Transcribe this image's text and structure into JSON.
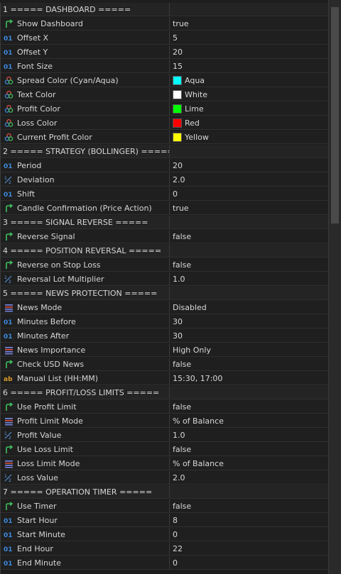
{
  "rows": [
    {
      "type": "group",
      "label": "1 ===== DASHBOARD ====="
    },
    {
      "type": "param",
      "icon": "bool",
      "label": "Show Dashboard",
      "value": "true"
    },
    {
      "type": "param",
      "icon": "int",
      "label": "Offset X",
      "value": "5"
    },
    {
      "type": "param",
      "icon": "int",
      "label": "Offset Y",
      "value": "20"
    },
    {
      "type": "param",
      "icon": "int",
      "label": "Font Size",
      "value": "15"
    },
    {
      "type": "param",
      "icon": "color",
      "label": "Spread Color (Cyan/Aqua)",
      "value": "Aqua",
      "swatch": "#00ffff"
    },
    {
      "type": "param",
      "icon": "color",
      "label": "Text Color",
      "value": "White",
      "swatch": "#ffffff"
    },
    {
      "type": "param",
      "icon": "color",
      "label": "Profit Color",
      "value": "Lime",
      "swatch": "#00ff00"
    },
    {
      "type": "param",
      "icon": "color",
      "label": "Loss Color",
      "value": "Red",
      "swatch": "#ff0000"
    },
    {
      "type": "param",
      "icon": "color",
      "label": "Current Profit Color",
      "value": "Yellow",
      "swatch": "#ffff00"
    },
    {
      "type": "group",
      "label": "2 ===== STRATEGY (BOLLINGER) ====="
    },
    {
      "type": "param",
      "icon": "int",
      "label": "Period",
      "value": "20"
    },
    {
      "type": "param",
      "icon": "double",
      "label": "Deviation",
      "value": "2.0"
    },
    {
      "type": "param",
      "icon": "int",
      "label": "Shift",
      "value": "0"
    },
    {
      "type": "param",
      "icon": "bool",
      "label": "Candle Confirmation (Price Action)",
      "value": "true"
    },
    {
      "type": "group",
      "label": "3 ===== SIGNAL REVERSE ====="
    },
    {
      "type": "param",
      "icon": "bool",
      "label": "Reverse Signal",
      "value": "false"
    },
    {
      "type": "group",
      "label": "4 ===== POSITION REVERSAL ====="
    },
    {
      "type": "param",
      "icon": "bool",
      "label": "Reverse on Stop Loss",
      "value": "false"
    },
    {
      "type": "param",
      "icon": "double",
      "label": "Reversal Lot Multiplier",
      "value": "1.0"
    },
    {
      "type": "group",
      "label": "5 ===== NEWS PROTECTION ====="
    },
    {
      "type": "param",
      "icon": "enum",
      "label": "News Mode",
      "value": "Disabled"
    },
    {
      "type": "param",
      "icon": "int",
      "label": "Minutes Before",
      "value": "30"
    },
    {
      "type": "param",
      "icon": "int",
      "label": "Minutes After",
      "value": "30"
    },
    {
      "type": "param",
      "icon": "enum",
      "label": "News Importance",
      "value": "High Only"
    },
    {
      "type": "param",
      "icon": "bool",
      "label": "Check USD News",
      "value": "false"
    },
    {
      "type": "param",
      "icon": "string",
      "label": "Manual List (HH:MM)",
      "value": "15:30, 17:00"
    },
    {
      "type": "group",
      "label": "6 ===== PROFIT/LOSS LIMITS ====="
    },
    {
      "type": "param",
      "icon": "bool",
      "label": "Use Profit Limit",
      "value": "false"
    },
    {
      "type": "param",
      "icon": "enum",
      "label": "Profit Limit Mode",
      "value": "% of Balance"
    },
    {
      "type": "param",
      "icon": "double",
      "label": "Profit Value",
      "value": "1.0"
    },
    {
      "type": "param",
      "icon": "bool",
      "label": "Use Loss Limit",
      "value": "false"
    },
    {
      "type": "param",
      "icon": "enum",
      "label": "Loss Limit Mode",
      "value": "% of Balance"
    },
    {
      "type": "param",
      "icon": "double",
      "label": "Loss Value",
      "value": "2.0"
    },
    {
      "type": "group",
      "label": "7 ===== OPERATION TIMER ====="
    },
    {
      "type": "param",
      "icon": "bool",
      "label": "Use Timer",
      "value": "false"
    },
    {
      "type": "param",
      "icon": "int",
      "label": "Start Hour",
      "value": "8"
    },
    {
      "type": "param",
      "icon": "int",
      "label": "Start Minute",
      "value": "0"
    },
    {
      "type": "param",
      "icon": "int",
      "label": "End Hour",
      "value": "22"
    },
    {
      "type": "param",
      "icon": "int",
      "label": "End Minute",
      "value": "0"
    }
  ],
  "icons": {
    "bool": "bool-arrow-icon",
    "int": "int-01-icon",
    "double": "double-half-icon",
    "color": "color-palette-icon",
    "enum": "enum-list-icon",
    "string": "string-ab-icon"
  }
}
